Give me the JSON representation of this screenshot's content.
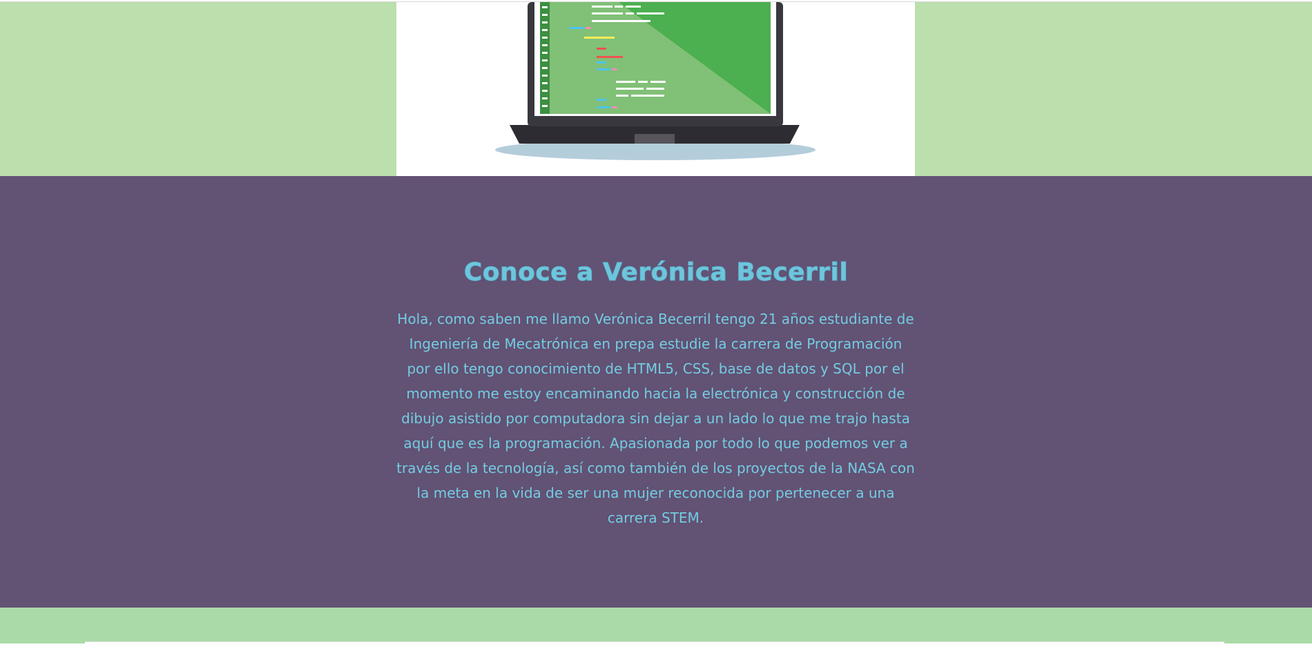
{
  "hero": {
    "image_icon": "laptop-code-illustration",
    "colors": {
      "band": "#bbdfad",
      "screen": "#4caf50",
      "screen_light": "#81c077",
      "laptop_body": "#2e2c33",
      "shadow": "#b3cddb"
    }
  },
  "about": {
    "title": "Conoce a Verónica Becerril",
    "paragraph": "Hola, como saben me llamo Verónica Becerril tengo 21 años estudiante de Ingeniería de Mecatrónica en prepa estudie la carrera de Programación por ello tengo conocimiento de HTML5, CSS, base de datos y SQL por el momento me estoy encaminando hacia la electrónica y construcción de dibujo asistido por computadora sin dejar a un lado lo que me trajo hasta aquí que es la programación. Apasionada por todo lo que podemos ver a través de la tecnología, así como también de los proyectos de la NASA con la meta en la vida de ser una mujer reconocida por pertenecer a una carrera STEM.",
    "colors": {
      "background": "#625274",
      "text": "#74cce2",
      "title": "#6ec6dc"
    }
  },
  "footer": {
    "colors": {
      "band": "#aadaa8",
      "card": "#ffffff"
    }
  }
}
